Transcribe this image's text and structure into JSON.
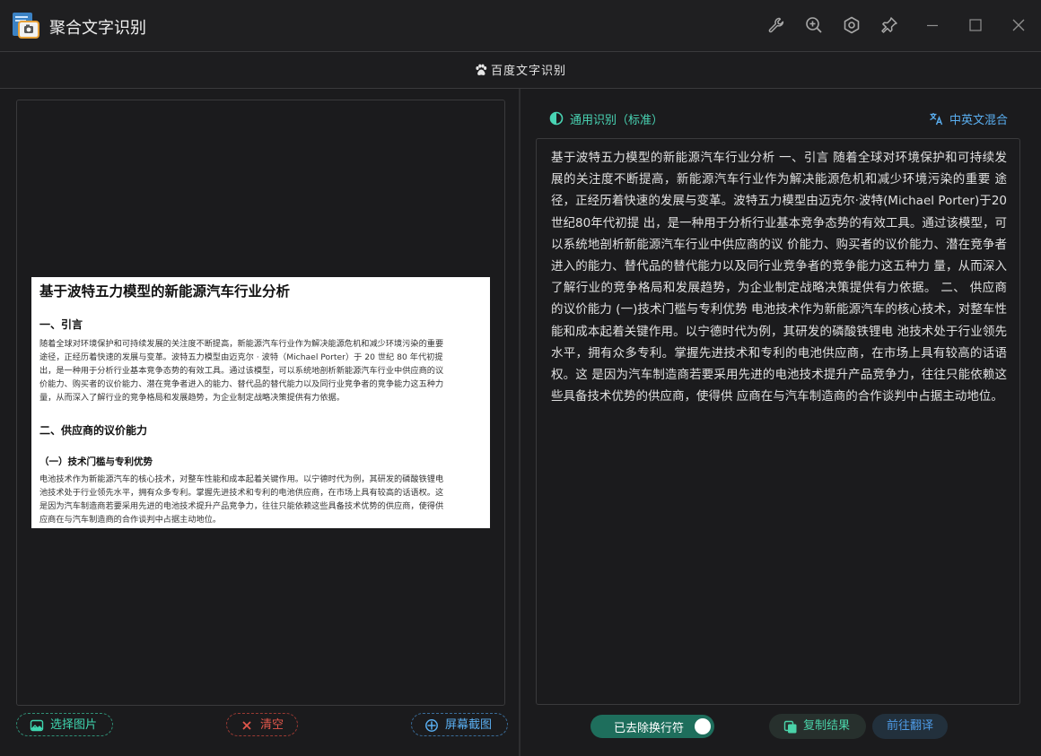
{
  "window": {
    "title": "聚合文字识别",
    "toolbar_icons": [
      "wrench-icon",
      "zoom-in-icon",
      "hexagon-settings-icon",
      "pin-icon"
    ],
    "controls": [
      "minimize-icon",
      "maximize-icon",
      "close-icon"
    ]
  },
  "engine": {
    "label": "百度文字识别",
    "icon": "paw-icon"
  },
  "preview": {
    "title": "基于波特五力模型的新能源汽车行业分析",
    "section1": "一、引言",
    "para1_lines": [
      "随着全球对环境保护和可持续发展的关注度不断提高，新能源汽车行业作为解决能源危机和减少环境污染的重要",
      "途径，正经历着快速的发展与变革。波特五力模型由迈克尔 · 波特（Michael Porter）于 20 世纪 80 年代初提",
      "出，是一种用于分析行业基本竞争态势的有效工具。通过该模型，可以系统地剖析新能源汽车行业中供应商的议",
      "价能力、购买者的议价能力、潜在竞争者进入的能力、替代品的替代能力以及同行业竞争者的竞争能力这五种力",
      "量，从而深入了解行业的竞争格局和发展趋势，为企业制定战略决策提供有力依据。"
    ],
    "section2": "二、供应商的议价能力",
    "subsection": "（一）技术门槛与专利优势",
    "para2_lines": [
      "电池技术作为新能源汽车的核心技术，对整车性能和成本起着关键作用。以宁德时代为例，其研发的磷酸铁锂电",
      "池技术处于行业领先水平，拥有众多专利。掌握先进技术和专利的电池供应商，在市场上具有较高的话语权。这",
      "是因为汽车制造商若要采用先进的电池技术提升产品竞争力，往往只能依赖这些具备技术优势的供应商，使得供",
      "应商在与汽车制造商的合作谈判中占据主动地位。"
    ]
  },
  "left_buttons": {
    "select_image": "选择图片",
    "clear": "清空",
    "screenshot": "屏幕截图"
  },
  "right": {
    "mode": "通用识别（标准）",
    "language": "中英文混合",
    "result_text": "基于波特五力模型的新能源汽车行业分析 一、引言 随着全球对环境保护和可持续发展的关注度不断提高，新能源汽车行业作为解决能源危机和减少环境污染的重要 途径，正经历着快速的发展与变革。波特五力模型由迈克尔·波特(Michael Porter)于20世纪80年代初提 出，是一种用于分析行业基本竞争态势的有效工具。通过该模型，可以系统地剖析新能源汽车行业中供应商的议 价能力、购买者的议价能力、潜在竞争者进入的能力、替代品的替代能力以及同行业竞争者的竞争能力这五种力 量，从而深入了解行业的竞争格局和发展趋势，为企业制定战略决策提供有力依据。 二、 供应商的议价能力 (一)技术门槛与专利优势 电池技术作为新能源汽车的核心技术，对整车性能和成本起着关键作用。以宁德时代为例，其研发的磷酸铁锂电 池技术处于行业领先水平，拥有众多专利。掌握先进技术和专利的电池供应商，在市场上具有较高的话语权。这 是因为汽车制造商若要采用先进的电池技术提升产品竞争力，往往只能依赖这些具备技术优势的供应商，使得供 应商在与汽车制造商的合作谈判中占据主动地位。",
    "toggle_label": "已去除换行符",
    "toggle_on": true,
    "copy_label": "复制结果",
    "translate_label": "前往翻译"
  },
  "colors": {
    "accent_green": "#3fd6b0",
    "accent_blue": "#5aaef0",
    "clear_red": "#e2574c",
    "background": "#1b1b1d"
  }
}
